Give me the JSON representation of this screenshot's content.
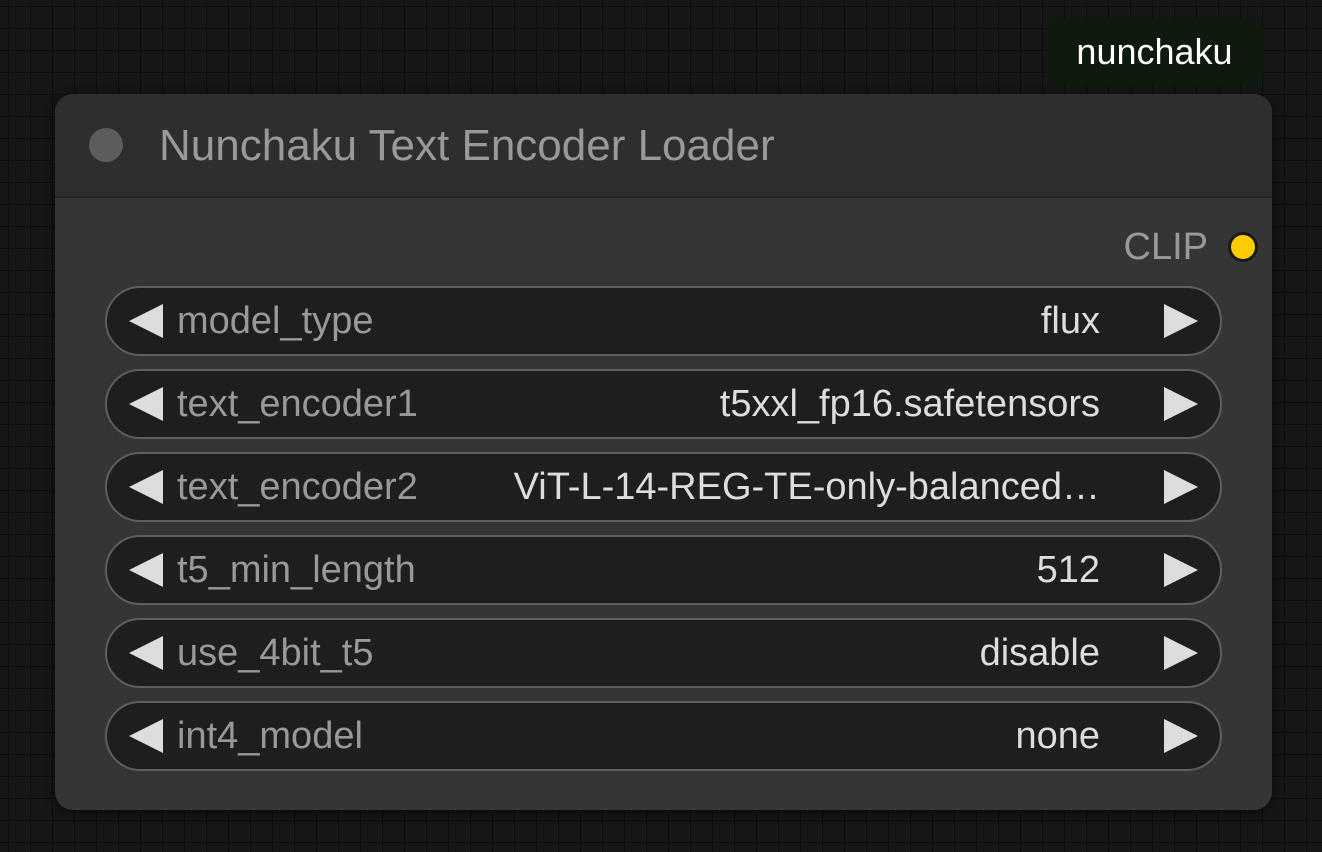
{
  "badge": {
    "label": "nunchaku"
  },
  "node": {
    "title": "Nunchaku Text Encoder Loader",
    "output": {
      "label": "CLIP",
      "color": "#ffcc00"
    },
    "widgets": [
      {
        "label": "model_type",
        "value": "flux"
      },
      {
        "label": "text_encoder1",
        "value": "t5xxl_fp16.safetensors"
      },
      {
        "label": "text_encoder2",
        "value": "ViT-L-14-REG-TE-only-balanced…"
      },
      {
        "label": "t5_min_length",
        "value": "512"
      },
      {
        "label": "use_4bit_t5",
        "value": "disable"
      },
      {
        "label": "int4_model",
        "value": "none"
      }
    ]
  }
}
